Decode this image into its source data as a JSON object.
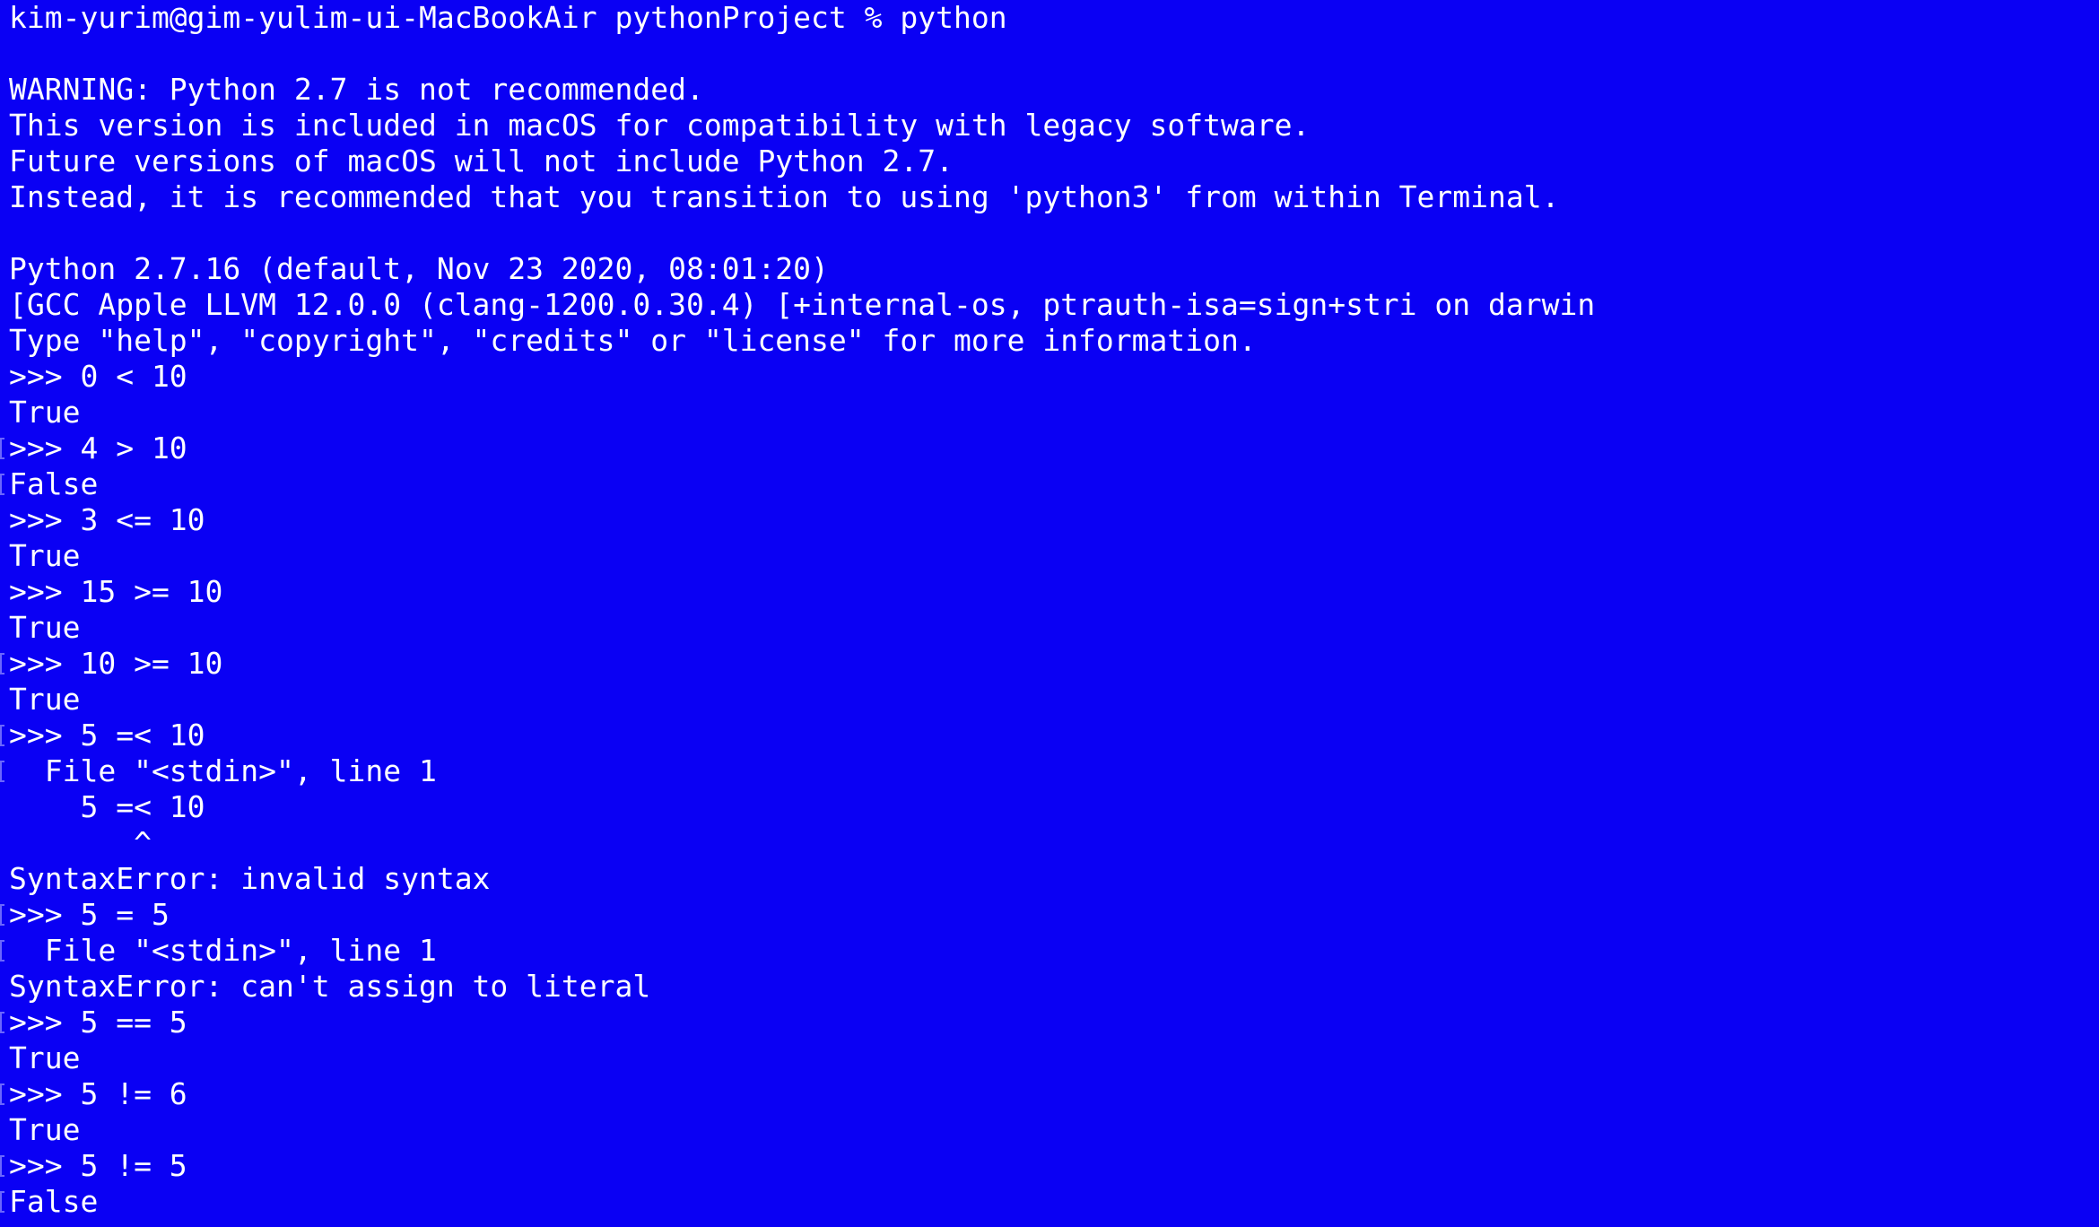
{
  "terminal": {
    "bg_color": "#0a00f4",
    "fg_color": "#ffffff",
    "lines": [
      {
        "text": "kim-yurim@gim-yulim-ui-MacBookAir pythonProject % python",
        "mark": false
      },
      {
        "text": "",
        "mark": false
      },
      {
        "text": "WARNING: Python 2.7 is not recommended.",
        "mark": false
      },
      {
        "text": "This version is included in macOS for compatibility with legacy software.",
        "mark": false
      },
      {
        "text": "Future versions of macOS will not include Python 2.7.",
        "mark": false
      },
      {
        "text": "Instead, it is recommended that you transition to using 'python3' from within Terminal.",
        "mark": false
      },
      {
        "text": "",
        "mark": false
      },
      {
        "text": "Python 2.7.16 (default, Nov 23 2020, 08:01:20)",
        "mark": false
      },
      {
        "text": "[GCC Apple LLVM 12.0.0 (clang-1200.0.30.4) [+internal-os, ptrauth-isa=sign+stri on darwin",
        "mark": false
      },
      {
        "text": "Type \"help\", \"copyright\", \"credits\" or \"license\" for more information.",
        "mark": false
      },
      {
        "text": ">>> 0 < 10",
        "mark": false
      },
      {
        "text": "True",
        "mark": false
      },
      {
        "text": ">>> 4 > 10",
        "mark": true
      },
      {
        "text": "False",
        "mark": true
      },
      {
        "text": ">>> 3 <= 10",
        "mark": false
      },
      {
        "text": "True",
        "mark": false
      },
      {
        "text": ">>> 15 >= 10",
        "mark": false
      },
      {
        "text": "True",
        "mark": false
      },
      {
        "text": ">>> 10 >= 10",
        "mark": true
      },
      {
        "text": "True",
        "mark": false
      },
      {
        "text": ">>> 5 =< 10",
        "mark": true
      },
      {
        "text": "  File \"<stdin>\", line 1",
        "mark": true
      },
      {
        "text": "    5 =< 10",
        "mark": false
      },
      {
        "text": "       ^",
        "mark": false
      },
      {
        "text": "SyntaxError: invalid syntax",
        "mark": false
      },
      {
        "text": ">>> 5 = 5",
        "mark": true
      },
      {
        "text": "  File \"<stdin>\", line 1",
        "mark": true
      },
      {
        "text": "SyntaxError: can't assign to literal",
        "mark": false
      },
      {
        "text": ">>> 5 == 5",
        "mark": true
      },
      {
        "text": "True",
        "mark": false
      },
      {
        "text": ">>> 5 != 6",
        "mark": true
      },
      {
        "text": "True",
        "mark": false
      },
      {
        "text": ">>> 5 != 5",
        "mark": true
      },
      {
        "text": "False",
        "mark": true
      },
      {
        "text": ">>>",
        "mark": false
      }
    ]
  }
}
